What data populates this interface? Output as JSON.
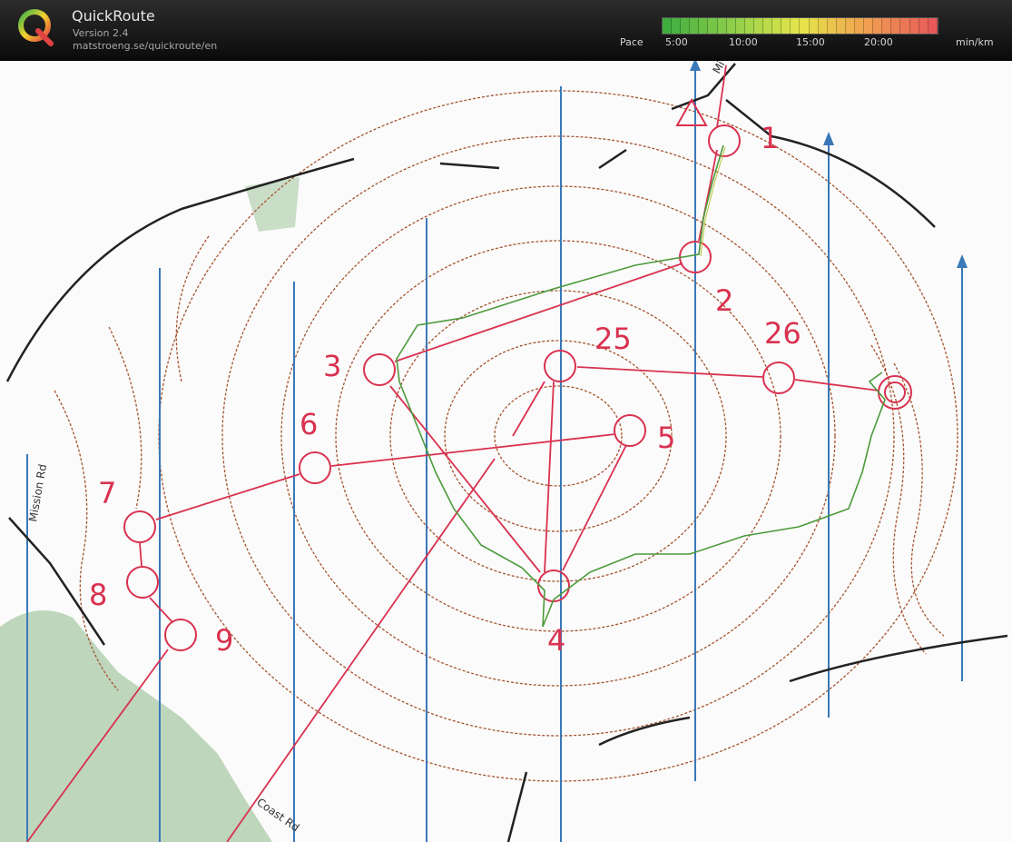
{
  "header": {
    "app_title": "QuickRoute",
    "version": "Version 2.4",
    "url": "matstroeng.se/quickroute/en",
    "pace_label": "Pace",
    "pace_unit": "min/km",
    "pace_ticks": [
      "5:00",
      "10:00",
      "15:00",
      "20:00"
    ],
    "pace_colors": [
      "#3fae3f",
      "#8fcf4a",
      "#e6e64a",
      "#f0a050",
      "#e85a5a"
    ]
  },
  "map": {
    "controls": {
      "c1": "1",
      "c2": "2",
      "c3": "3",
      "c4": "4",
      "c5": "5",
      "c6": "6",
      "c7": "7",
      "c8": "8",
      "c9": "9",
      "c25": "25",
      "c26": "26"
    },
    "roads": {
      "mission": "Mission Rd",
      "coast": "Coast Rd",
      "top": "Mi"
    },
    "colors": {
      "course": "#d9314f",
      "contour": "#a4532e",
      "road": "#222222",
      "north_line": "#3a78b8",
      "route": "#4b9a3b",
      "vegetation": "#8fb88d"
    }
  }
}
